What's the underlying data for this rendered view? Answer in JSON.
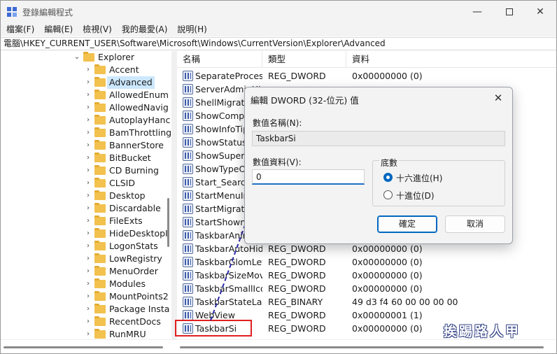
{
  "window": {
    "title": "登錄編輯程式"
  },
  "menu": [
    "檔案(F)",
    "編輯(E)",
    "檢視(V)",
    "我的最愛(A)",
    "說明(H)"
  ],
  "address": "電腦\\HKEY_CURRENT_USER\\Software\\Microsoft\\Windows\\CurrentVersion\\Explorer\\Advanced",
  "tree": {
    "parent": "Explorer",
    "items": [
      "Accent",
      "Advanced",
      "AllowedEnum",
      "AllowedNavig",
      "AutoplayHanc",
      "BamThrottling",
      "BannerStore",
      "BitBucket",
      "CD Burning",
      "CLSID",
      "Desktop",
      "Discardable",
      "FileExts",
      "HideDesktopI",
      "LogonStats",
      "LowRegistry",
      "MenuOrder",
      "Modules",
      "MountPoints2",
      "Package Insta",
      "RecentDocs",
      "RunMRU"
    ],
    "selected": "Advanced"
  },
  "columns": {
    "name": "名稱",
    "type": "類型",
    "data": "資料"
  },
  "rows": [
    {
      "name": "SeparateProcess",
      "type": "REG_DWORD",
      "data": "0x00000000 (0)"
    },
    {
      "name": "ServerAdminUI",
      "type": "",
      "data": ""
    },
    {
      "name": "ShellMigration",
      "type": "",
      "data": ""
    },
    {
      "name": "ShowCompColor",
      "type": "",
      "data": ""
    },
    {
      "name": "ShowInfoTip",
      "type": "",
      "data": ""
    },
    {
      "name": "ShowStatusBar",
      "type": "",
      "data": ""
    },
    {
      "name": "ShowSuperHidden",
      "type": "",
      "data": ""
    },
    {
      "name": "ShowTypeOverlay",
      "type": "",
      "data": ""
    },
    {
      "name": "Start_SearchFiles",
      "type": "",
      "data": ""
    },
    {
      "name": "StartMenuInit",
      "type": "",
      "data": ""
    },
    {
      "name": "StartMigratedBrowser",
      "type": "",
      "data": ""
    },
    {
      "name": "StartShownOnUpgrade",
      "type": "",
      "data": ""
    },
    {
      "name": "TaskbarAnimations",
      "type": "",
      "data": ""
    },
    {
      "name": "TaskbarAutoHideInTablet",
      "type": "REG_DWORD",
      "data": "0x00000000 (0)"
    },
    {
      "name": "TaskbarGlomLevel",
      "type": "REG_DWORD",
      "data": "0x00000000 (0)"
    },
    {
      "name": "TaskbarSizeMove",
      "type": "REG_DWORD",
      "data": "0x00000000 (0)"
    },
    {
      "name": "TaskbarSmallIcons",
      "type": "REG_DWORD",
      "data": "0x00000000 (0)"
    },
    {
      "name": "TaskbarStateLastRun",
      "type": "REG_BINARY",
      "data": "49 d3 f4 60 00 00 00 00"
    },
    {
      "name": "WebView",
      "type": "REG_DWORD",
      "data": "0x00000001 (1)"
    },
    {
      "name": "TaskbarSi",
      "type": "REG_DWORD",
      "data": "0x00000000 (0)"
    }
  ],
  "dialog": {
    "title": "編輯 DWORD (32-位元) 值",
    "value_name_label": "數值名稱(N):",
    "value_name": "TaskbarSi",
    "value_data_label": "數值資料(V):",
    "value_data": "0",
    "base_label": "底數",
    "hex_label": "十六進位(H)",
    "dec_label": "十進位(D)",
    "ok": "確定",
    "cancel": "取消"
  },
  "watermark": "挨踢路人甲",
  "colors": {
    "accent": "#0067c0",
    "highlight_box": "#e02020",
    "arrow": "#2a2aa8"
  }
}
